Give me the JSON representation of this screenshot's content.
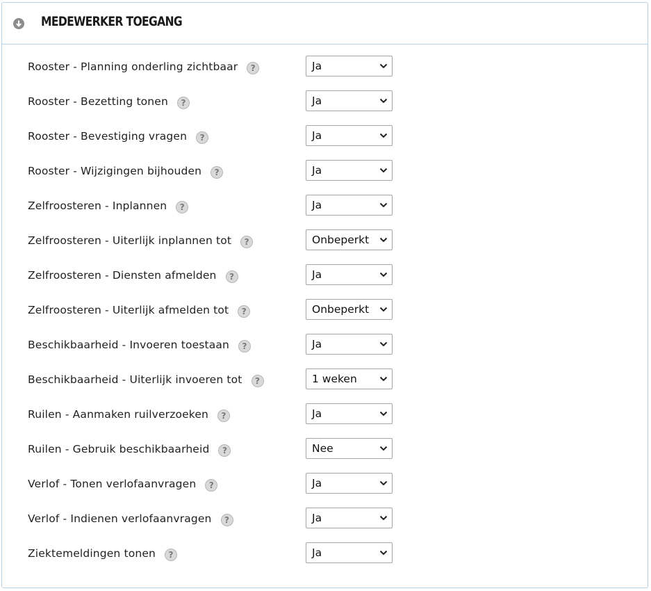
{
  "panel": {
    "title": "MEDEWERKER TOEGANG",
    "collapse_icon": "arrow-down-circle-icon"
  },
  "help_glyph": "?",
  "settings": [
    {
      "label": "Rooster - Planning onderling zichtbaar",
      "value": "Ja"
    },
    {
      "label": "Rooster - Bezetting tonen",
      "value": "Ja"
    },
    {
      "label": "Rooster - Bevestiging vragen",
      "value": "Ja"
    },
    {
      "label": "Rooster - Wijzigingen bijhouden",
      "value": "Ja"
    },
    {
      "label": "Zelfroosteren - Inplannen",
      "value": "Ja"
    },
    {
      "label": "Zelfroosteren - Uiterlijk inplannen tot",
      "value": "Onbeperkt"
    },
    {
      "label": "Zelfroosteren - Diensten afmelden",
      "value": "Ja"
    },
    {
      "label": "Zelfroosteren - Uiterlijk afmelden tot",
      "value": "Onbeperkt"
    },
    {
      "label": "Beschikbaarheid - Invoeren toestaan",
      "value": "Ja"
    },
    {
      "label": "Beschikbaarheid - Uiterlijk invoeren tot",
      "value": "1 weken"
    },
    {
      "label": "Ruilen - Aanmaken ruilverzoeken",
      "value": "Ja"
    },
    {
      "label": "Ruilen - Gebruik beschikbaarheid",
      "value": "Nee"
    },
    {
      "label": "Verlof - Tonen verlofaanvragen",
      "value": "Ja"
    },
    {
      "label": "Verlof - Indienen verlofaanvragen",
      "value": "Ja"
    },
    {
      "label": "Ziektemeldingen tonen",
      "value": "Ja"
    }
  ]
}
